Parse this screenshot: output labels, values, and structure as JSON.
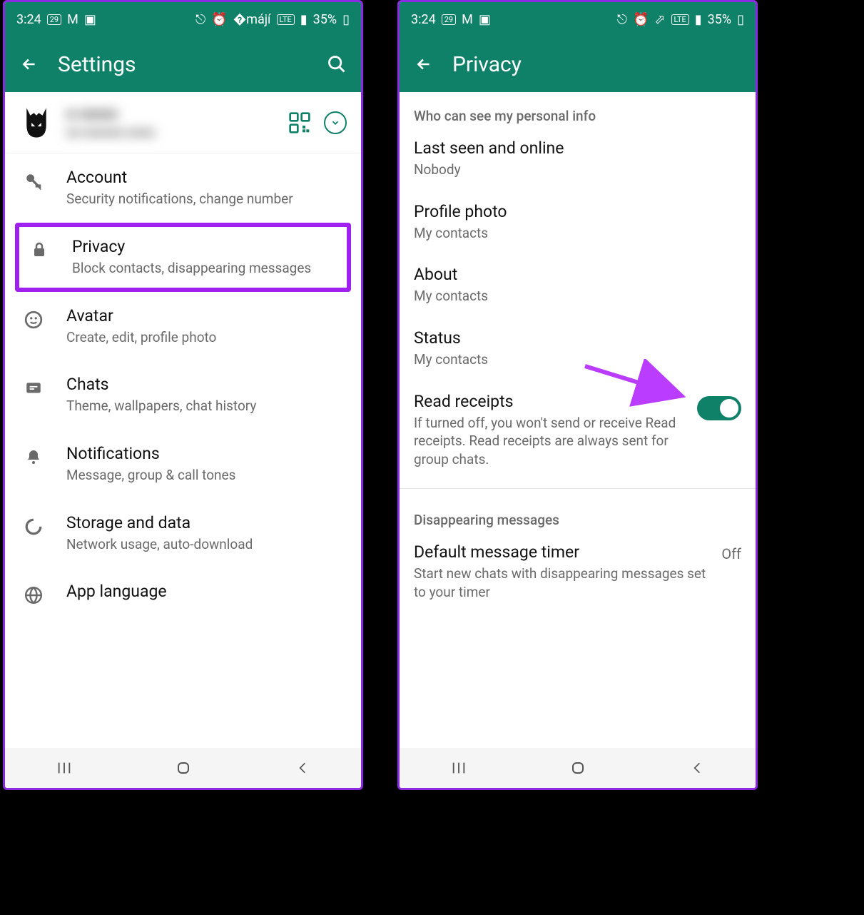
{
  "statusbar": {
    "time": "3:24",
    "date_badge": "29",
    "battery": "35%"
  },
  "left_screen": {
    "appbar_title": "Settings",
    "profile_name_blur": "■ ■■■■",
    "profile_sub_blur": "■■ ■■■■■■ ■■■■",
    "items": [
      {
        "title": "Account",
        "subtitle": "Security notifications, change number"
      },
      {
        "title": "Privacy",
        "subtitle": "Block contacts, disappearing messages"
      },
      {
        "title": "Avatar",
        "subtitle": "Create, edit, profile photo"
      },
      {
        "title": "Chats",
        "subtitle": "Theme, wallpapers, chat history"
      },
      {
        "title": "Notifications",
        "subtitle": "Message, group & call tones"
      },
      {
        "title": "Storage and data",
        "subtitle": "Network usage, auto-download"
      },
      {
        "title": "App language",
        "subtitle": ""
      }
    ]
  },
  "right_screen": {
    "appbar_title": "Privacy",
    "section1": "Who can see my personal info",
    "items": [
      {
        "title": "Last seen and online",
        "subtitle": "Nobody"
      },
      {
        "title": "Profile photo",
        "subtitle": "My contacts"
      },
      {
        "title": "About",
        "subtitle": "My contacts"
      },
      {
        "title": "Status",
        "subtitle": "My contacts"
      }
    ],
    "read_receipts": {
      "title": "Read receipts",
      "subtitle": "If turned off, you won't send or receive Read receipts. Read receipts are always sent for group chats.",
      "on": true
    },
    "section2": "Disappearing messages",
    "default_timer": {
      "title": "Default message timer",
      "subtitle": "Start new chats with disappearing messages set to your timer",
      "value": "Off"
    }
  }
}
